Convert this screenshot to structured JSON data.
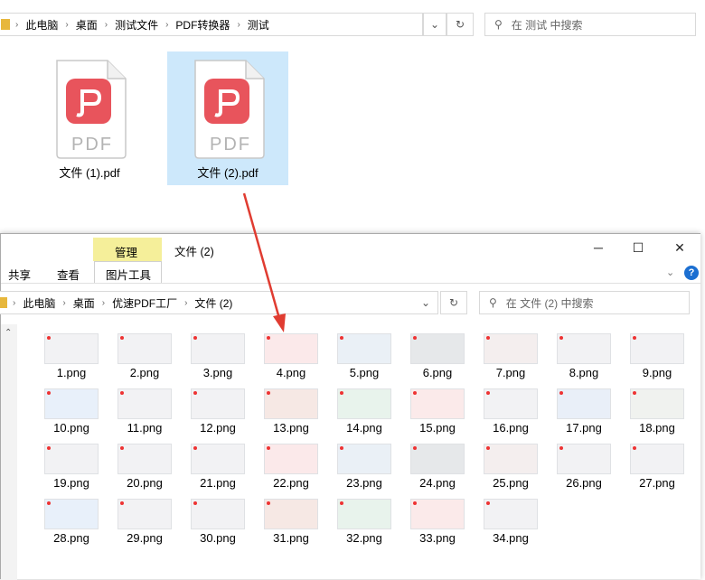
{
  "top": {
    "breadcrumbs": [
      "此电脑",
      "桌面",
      "测试文件",
      "PDF转换器",
      "测试"
    ],
    "search_placeholder": "在 测试 中搜索",
    "files": [
      {
        "label": "文件 (1).pdf",
        "selected": false
      },
      {
        "label": "文件 (2).pdf",
        "selected": true
      }
    ],
    "pdf_text": "PDF"
  },
  "win": {
    "title": "文件 (2)",
    "ribbon_manage": "管理",
    "tab_share": "共享",
    "tab_view": "查看",
    "tab_picture": "图片工具",
    "breadcrumbs": [
      "此电脑",
      "桌面",
      "优速PDF工厂",
      "文件 (2)"
    ],
    "search_placeholder": "在 文件 (2) 中搜索",
    "files": [
      "1.png",
      "2.png",
      "3.png",
      "4.png",
      "5.png",
      "6.png",
      "7.png",
      "8.png",
      "9.png",
      "10.png",
      "11.png",
      "12.png",
      "13.png",
      "14.png",
      "15.png",
      "16.png",
      "17.png",
      "18.png",
      "19.png",
      "20.png",
      "21.png",
      "22.png",
      "23.png",
      "24.png",
      "25.png",
      "26.png",
      "27.png",
      "28.png",
      "29.png",
      "30.png",
      "31.png",
      "32.png",
      "33.png",
      "34.png"
    ]
  },
  "colors": {
    "accent": "#e8545c",
    "selected": "#cde8fb",
    "manage_tab": "#f5ef9a",
    "arrow": "#e03c31"
  }
}
